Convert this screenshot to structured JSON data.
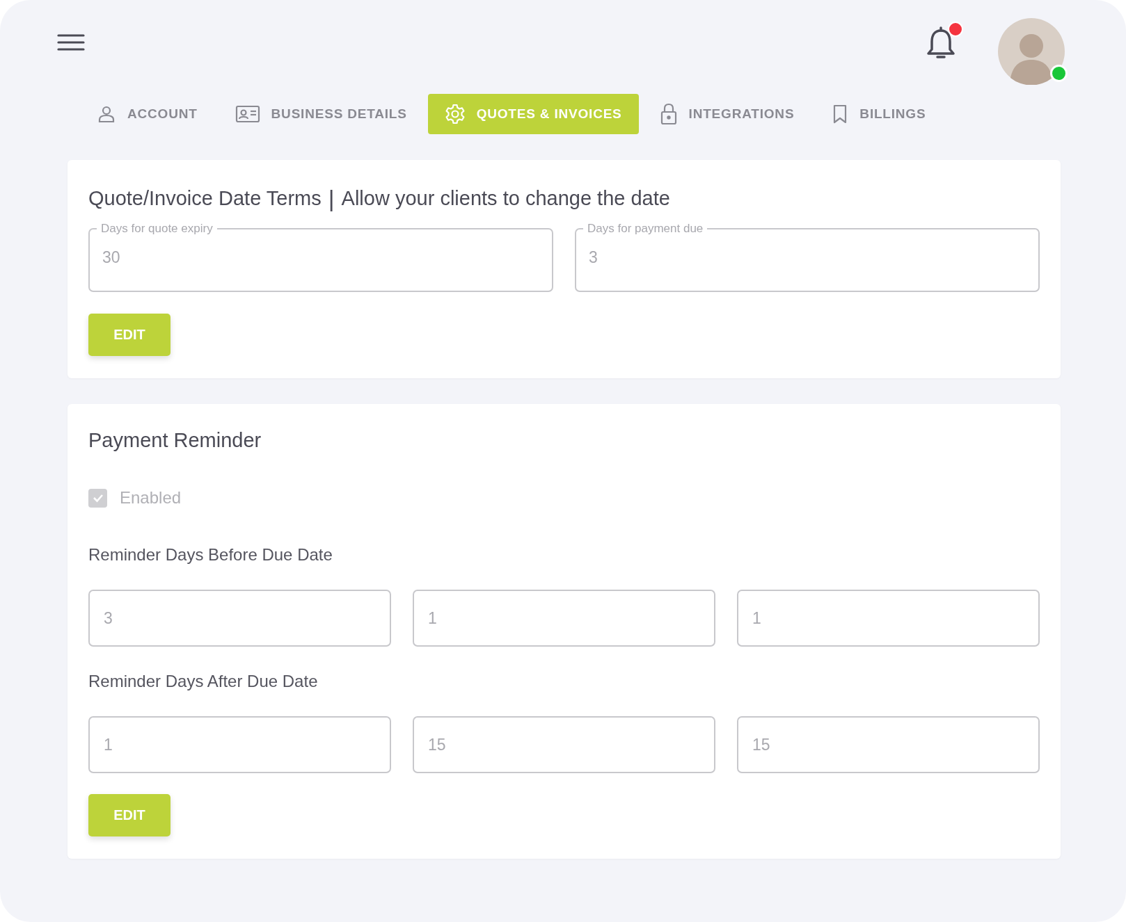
{
  "header": {
    "notification_badge": true,
    "avatar": {
      "online": true
    }
  },
  "tabs": [
    {
      "label": "ACCOUNT",
      "kind": "person",
      "selected": false
    },
    {
      "label": "BUSINESS DETAILS",
      "kind": "idcard",
      "selected": false
    },
    {
      "label": "QUOTES & INVOICES",
      "kind": "gear",
      "selected": true
    },
    {
      "label": "INTEGRATIONS",
      "kind": "lock",
      "selected": false
    },
    {
      "label": "BILLINGS",
      "kind": "bookmark",
      "selected": false
    }
  ],
  "date_terms": {
    "title": "Quote/Invoice Date Terms",
    "separator": "|",
    "subtitle": "Allow your clients to change the date",
    "fields": [
      {
        "label": "Days for quote expiry",
        "value": "30"
      },
      {
        "label": "Days for payment due",
        "value": "3"
      }
    ],
    "button": "EDIT"
  },
  "payment_reminder": {
    "title": "Payment Reminder",
    "enabled": {
      "label": "Enabled",
      "checked": true,
      "disabled": true
    },
    "groups": [
      {
        "label": "Reminder Days Before Due Date",
        "values": [
          "3",
          "1",
          "1"
        ]
      },
      {
        "label": "Reminder Days After Due Date",
        "values": [
          "1",
          "15",
          "15"
        ]
      }
    ],
    "button": "EDIT"
  }
}
